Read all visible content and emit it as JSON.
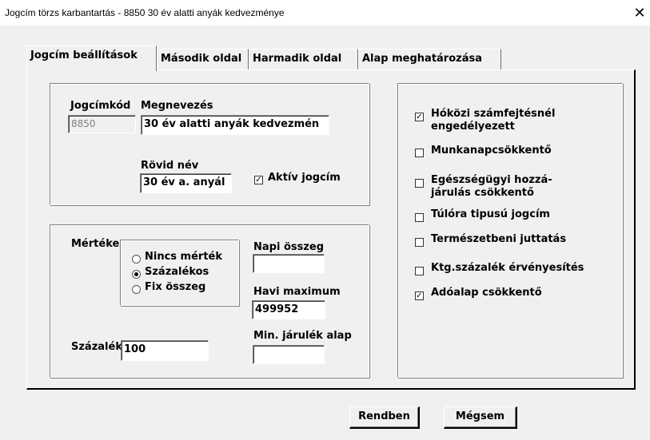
{
  "window": {
    "title": "Jogcím törzs karbantartás - 8850 30 év alatti anyák kedvezménye",
    "close_icon": "close-icon"
  },
  "tabs": [
    {
      "label": "Jogcím beállítások",
      "active": true
    },
    {
      "label": "Második oldal",
      "active": false
    },
    {
      "label": "Harmadik oldal",
      "active": false
    },
    {
      "label": "Alap meghatározása",
      "active": false
    }
  ],
  "identity": {
    "code_label": "Jogcímkód",
    "code_value": "8850",
    "name_label": "Megnevezés",
    "name_value": "30 év alatti anyák kedvezmén",
    "short_label": "Rövid név",
    "short_value": "30 év a. anyál",
    "active_label": "Aktív jogcím",
    "active_checked": true
  },
  "measure": {
    "label": "Mértéke",
    "options": [
      {
        "label": "Nincs mérték",
        "selected": false
      },
      {
        "label": "Százalékos",
        "selected": true
      },
      {
        "label": "Fix összeg",
        "selected": false
      }
    ],
    "daily_label": "Napi összeg",
    "daily_value": "",
    "monthly_max_label": "Havi maximum",
    "monthly_max_value": "499952",
    "percent_label": "Százalék",
    "percent_value": "100",
    "min_base_label": "Min. járulék alap",
    "min_base_value": ""
  },
  "flags": [
    {
      "label": "Hóközi számfejtésnél engedélyezett",
      "line1": "Hóközi számfejtésnél",
      "line2": "engedélyezett",
      "checked": true
    },
    {
      "label": "Munkanapcsökkentő",
      "line1": "Munkanapcsökkentő",
      "line2": "",
      "checked": false
    },
    {
      "label": "Egészségügyi hozzá-járulás csökkentő",
      "line1": "Egészségügyi hozzá-",
      "line2": "járulás csökkentő",
      "checked": false
    },
    {
      "label": "Túlóra tipusú jogcím",
      "line1": "Túlóra tipusú jogcím",
      "line2": "",
      "checked": false
    },
    {
      "label": "Természetbeni juttatás",
      "line1": "Természetbeni juttatás",
      "line2": "",
      "checked": false
    },
    {
      "label": "Ktg.százalék érvényesítés",
      "line1": "Ktg.százalék érvényesítés",
      "line2": "",
      "checked": false
    },
    {
      "label": "Adóalap csökkentő",
      "line1": "Adóalap csökkentő",
      "line2": "",
      "checked": true
    }
  ],
  "buttons": {
    "ok": "Rendben",
    "cancel": "Mégsem"
  }
}
